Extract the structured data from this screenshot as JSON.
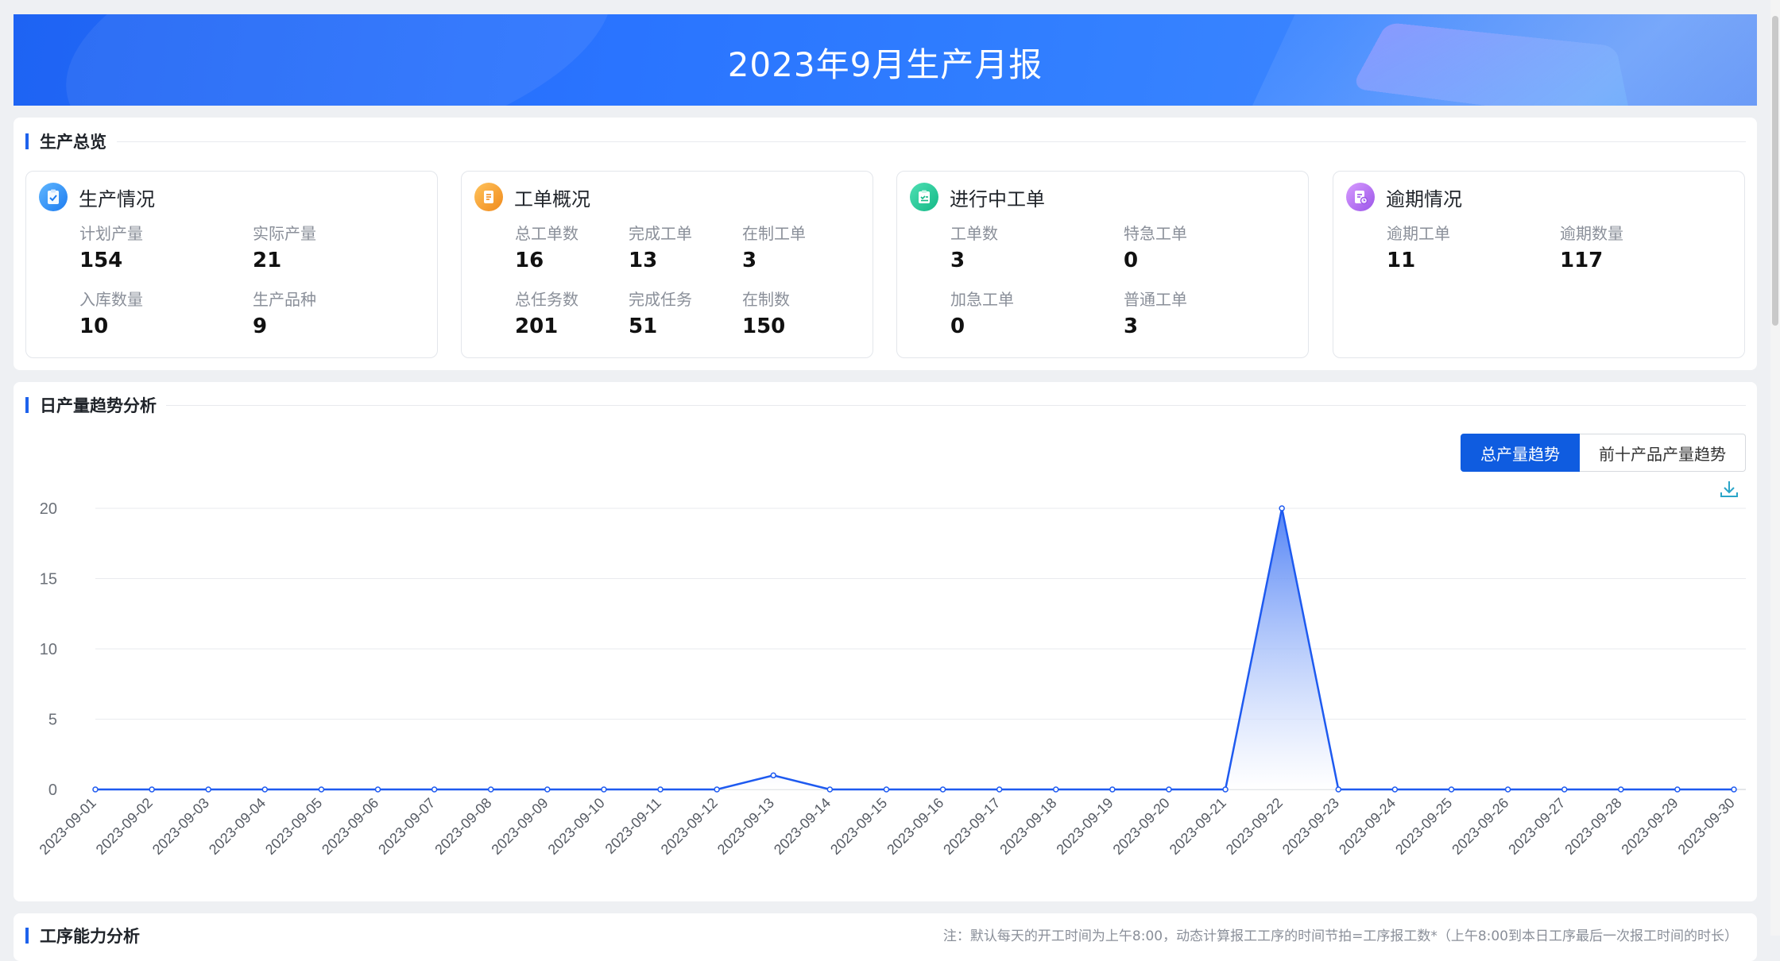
{
  "banner": {
    "title": "2023年9月生产月报"
  },
  "overview": {
    "title": "生产总览",
    "cards": [
      {
        "title": "生产情况",
        "icon": "clipboard-check-icon",
        "color": "#2f8cf5",
        "metrics": [
          {
            "label": "计划产量",
            "value": "154"
          },
          {
            "label": "实际产量",
            "value": "21"
          },
          {
            "label": "入库数量",
            "value": "10"
          },
          {
            "label": "生产品种",
            "value": "9"
          }
        ]
      },
      {
        "title": "工单概况",
        "icon": "document-list-icon",
        "color": "#f59a23",
        "metrics": [
          {
            "label": "总工单数",
            "value": "16"
          },
          {
            "label": "完成工单",
            "value": "13"
          },
          {
            "label": "在制工单",
            "value": "3"
          },
          {
            "label": "总任务数",
            "value": "201"
          },
          {
            "label": "完成任务",
            "value": "51"
          },
          {
            "label": "在制数",
            "value": "150"
          }
        ]
      },
      {
        "title": "进行中工单",
        "icon": "task-board-icon",
        "color": "#1fc79a",
        "metrics": [
          {
            "label": "工单数",
            "value": "3"
          },
          {
            "label": "特急工单",
            "value": "0"
          },
          {
            "label": "加急工单",
            "value": "0"
          },
          {
            "label": "普通工单",
            "value": "3"
          }
        ]
      },
      {
        "title": "逾期情况",
        "icon": "overdue-document-icon",
        "color": "#b46af0",
        "metrics": [
          {
            "label": "逾期工单",
            "value": "11"
          },
          {
            "label": "逾期数量",
            "value": "117"
          }
        ]
      }
    ]
  },
  "trend": {
    "title": "日产量趋势分析",
    "tabs": [
      {
        "label": "总产量趋势",
        "active": true
      },
      {
        "label": "前十产品产量趋势",
        "active": false
      }
    ],
    "download_icon": "download-icon"
  },
  "chart_data": {
    "type": "area",
    "x": [
      "2023-09-01",
      "2023-09-02",
      "2023-09-03",
      "2023-09-04",
      "2023-09-05",
      "2023-09-06",
      "2023-09-07",
      "2023-09-08",
      "2023-09-09",
      "2023-09-10",
      "2023-09-11",
      "2023-09-12",
      "2023-09-13",
      "2023-09-14",
      "2023-09-15",
      "2023-09-16",
      "2023-09-17",
      "2023-09-18",
      "2023-09-19",
      "2023-09-20",
      "2023-09-21",
      "2023-09-22",
      "2023-09-23",
      "2023-09-24",
      "2023-09-25",
      "2023-09-26",
      "2023-09-27",
      "2023-09-28",
      "2023-09-29",
      "2023-09-30"
    ],
    "values": [
      0,
      0,
      0,
      0,
      0,
      0,
      0,
      0,
      0,
      0,
      0,
      0,
      1,
      0,
      0,
      0,
      0,
      0,
      0,
      0,
      0,
      20,
      0,
      0,
      0,
      0,
      0,
      0,
      0,
      0
    ],
    "yticks": [
      0,
      5,
      10,
      15,
      20
    ],
    "ylim": [
      0,
      20
    ],
    "grid": true,
    "color": "#1e5af0"
  },
  "capacity": {
    "title": "工序能力分析",
    "note": "注：默认每天的开工时间为上午8:00，动态计算报工工序的时间节拍=工序报工数*（上午8:00到本日工序最后一次报工时间的时长）"
  }
}
